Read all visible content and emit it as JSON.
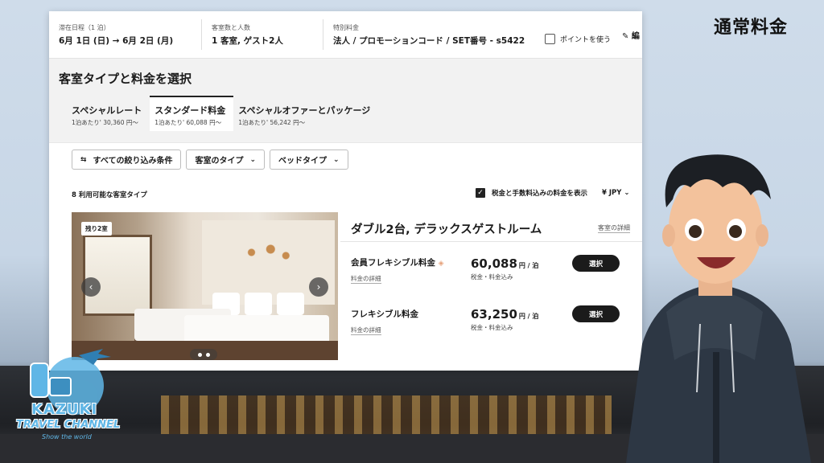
{
  "overlay": {
    "title": "通常料金",
    "logo_line1": "KAZUKI",
    "logo_line2": "TRAVEL CHANNEL",
    "logo_line3": "Show the world"
  },
  "header": {
    "stay_label": "滞在日程（1 泊）",
    "stay_value": "6月 1日 (日) → 6月 2日 (月)",
    "rooms_label": "客室数と人数",
    "rooms_value": "1 客室, ゲスト2人",
    "special_label": "特別料金",
    "special_value": "法人 / プロモーションコード / SET番号 - s5422",
    "points_label": "ポイントを使う",
    "edit_label": "編"
  },
  "page_title": "客室タイプと料金を選択",
  "tabs": [
    {
      "label": "スペシャルレート",
      "sub": "1泊あたり' 30,360 円〜",
      "active": false
    },
    {
      "label": "スタンダード料金",
      "sub": "1泊あたり' 60,088 円〜",
      "active": true
    },
    {
      "label": "スペシャルオファーとパッケージ",
      "sub": "1泊あたり' 56,242 円〜",
      "active": false
    }
  ],
  "filters": {
    "all": "すべての絞り込み条件",
    "room_type": "客室のタイプ",
    "bed_type": "ベッドタイプ"
  },
  "available_count": "8 利用可能な客室タイプ",
  "tax_toggle_label": "税金と手数料込みの料金を表示",
  "currency": "¥ JPY",
  "room": {
    "badge": "残り2室",
    "name": "ダブル2台, デラックスゲストルーム",
    "details_link": "客室の詳細",
    "rates": [
      {
        "name": "会員フレキシブル料金",
        "detail": "料金の詳細",
        "amount": "60,088",
        "unit": "円 / 泊",
        "includes": "税金・料金込み",
        "button": "選択"
      },
      {
        "name": "フレキシブル料金",
        "detail": "料金の詳細",
        "amount": "63,250",
        "unit": "円 / 泊",
        "includes": "税金・料金込み",
        "button": "選択"
      }
    ]
  },
  "colors": {
    "accent": "#1b1b1b",
    "logo": "#5fb6e6",
    "tag": "#e6a17a"
  }
}
